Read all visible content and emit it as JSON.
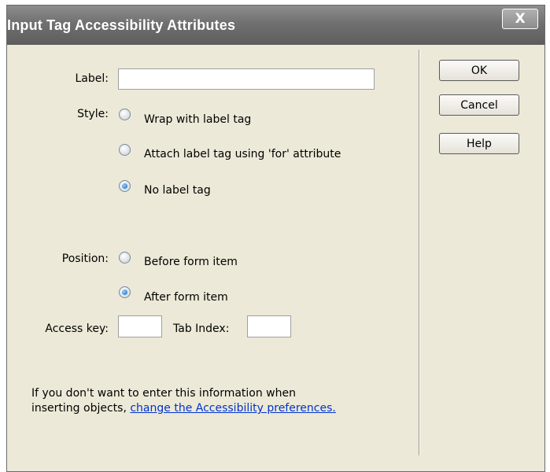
{
  "window": {
    "title": "Input Tag Accessibility Attributes",
    "close_label": "X"
  },
  "form": {
    "label_caption": "Label:",
    "label_value": "",
    "style_caption": "Style:",
    "style_options": [
      {
        "label": "Wrap with label tag",
        "selected": false
      },
      {
        "label": "Attach label tag using 'for' attribute",
        "selected": false
      },
      {
        "label": "No label tag",
        "selected": true
      }
    ],
    "position_caption": "Position:",
    "position_options": [
      {
        "label": "Before form item",
        "selected": false
      },
      {
        "label": "After form item",
        "selected": true
      }
    ],
    "access_key_caption": "Access key:",
    "access_key_value": "",
    "tab_index_caption": "Tab Index:",
    "tab_index_value": ""
  },
  "footer": {
    "note_line1": "If you don't want to enter this information when",
    "note_line2": "inserting objects,",
    "link_text": "change the Accessibility preferences."
  },
  "buttons": {
    "ok": "OK",
    "cancel": "Cancel",
    "help": "Help"
  }
}
